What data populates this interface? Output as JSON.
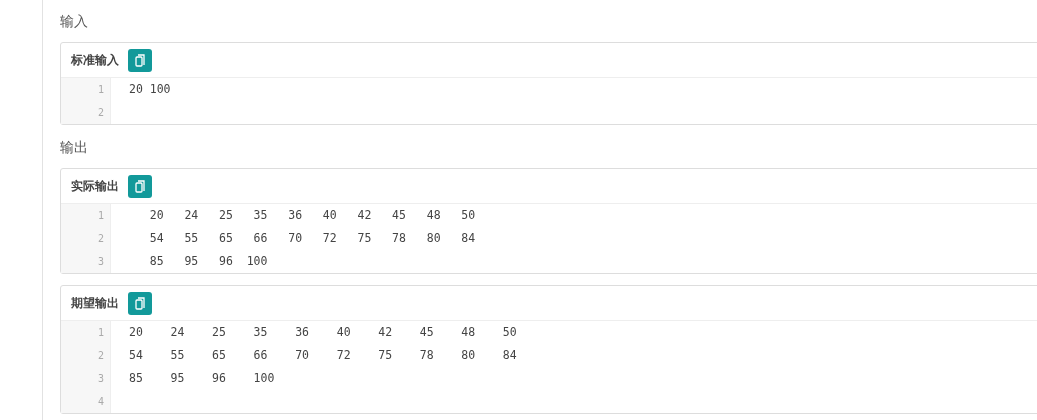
{
  "sections": [
    {
      "heading": "输入",
      "panels": [
        {
          "title": "标准输入",
          "lines": [
            {
              "number": "1",
              "text": "20 100"
            },
            {
              "number": "2"
            }
          ]
        }
      ]
    },
    {
      "heading": "输出",
      "panels": [
        {
          "title": "实际输出",
          "lines": [
            {
              "number": "1",
              "text": "   20   24   25   35   36   40   42   45   48   50"
            },
            {
              "number": "2",
              "text": "   54   55   65   66   70   72   75   78   80   84"
            },
            {
              "number": "3",
              "text": "   85   95   96  100"
            }
          ]
        },
        {
          "title": "期望输出",
          "lines": [
            {
              "number": "1",
              "text": "20    24    25    35    36    40    42    45    48    50"
            },
            {
              "number": "2",
              "text": "54    55    65    66    70    72    75    78    80    84"
            },
            {
              "number": "3",
              "text": "85    95    96    100"
            },
            {
              "number": "4"
            }
          ]
        }
      ]
    }
  ]
}
